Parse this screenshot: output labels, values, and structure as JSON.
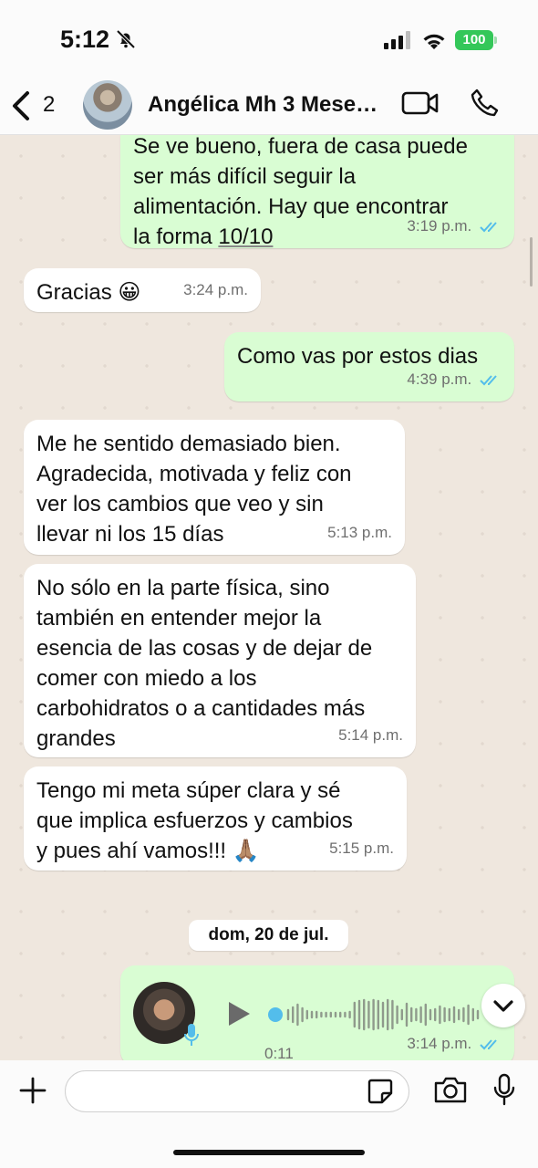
{
  "status_bar": {
    "time": "5:12",
    "battery": "100"
  },
  "header": {
    "back_count": "2",
    "contact_name": "Angélica Mh 3 Mese…"
  },
  "messages": [
    {
      "dir": "out",
      "lines": [
        "Se ve bueno, fuera de casa puede",
        "ser más difícil seguir la",
        "alimentación. Hay que encontrar",
        "la forma 10/10"
      ],
      "time": "3:19 p.m."
    },
    {
      "dir": "in",
      "text": "Gracias 😀",
      "time": "3:24 p.m."
    },
    {
      "dir": "out",
      "text": "Como vas por estos dias",
      "time": "4:39 p.m."
    },
    {
      "dir": "in",
      "lines": [
        "Me he sentido demasiado bien.",
        "Agradecida, motivada y feliz con",
        "ver los cambios que veo y sin",
        "llevar ni los 15 días"
      ],
      "time": "5:13 p.m."
    },
    {
      "dir": "in",
      "lines": [
        "No sólo en la parte física, sino",
        "también en entender mejor la",
        "esencia de las cosas y de dejar de",
        "comer con miedo a los",
        "carbohidratos o a cantidades más",
        "grandes"
      ],
      "time": "5:14 p.m."
    },
    {
      "dir": "in",
      "lines": [
        "Tengo mi meta súper clara y sé",
        "que implica esfuerzos y cambios",
        "y pues ahí vamos!!! 🙏🏽"
      ],
      "time": "5:15 p.m."
    }
  ],
  "date_separator": "dom, 20 de jul.",
  "voice_message": {
    "duration": "0:11",
    "time": "3:14 p.m.",
    "progress": 0
  },
  "input": {
    "placeholder": "",
    "value": ""
  },
  "colors": {
    "outgoing": "#d9fdd3",
    "incoming": "#ffffff",
    "ticks": "#53bdeb",
    "battery": "#34c759"
  }
}
